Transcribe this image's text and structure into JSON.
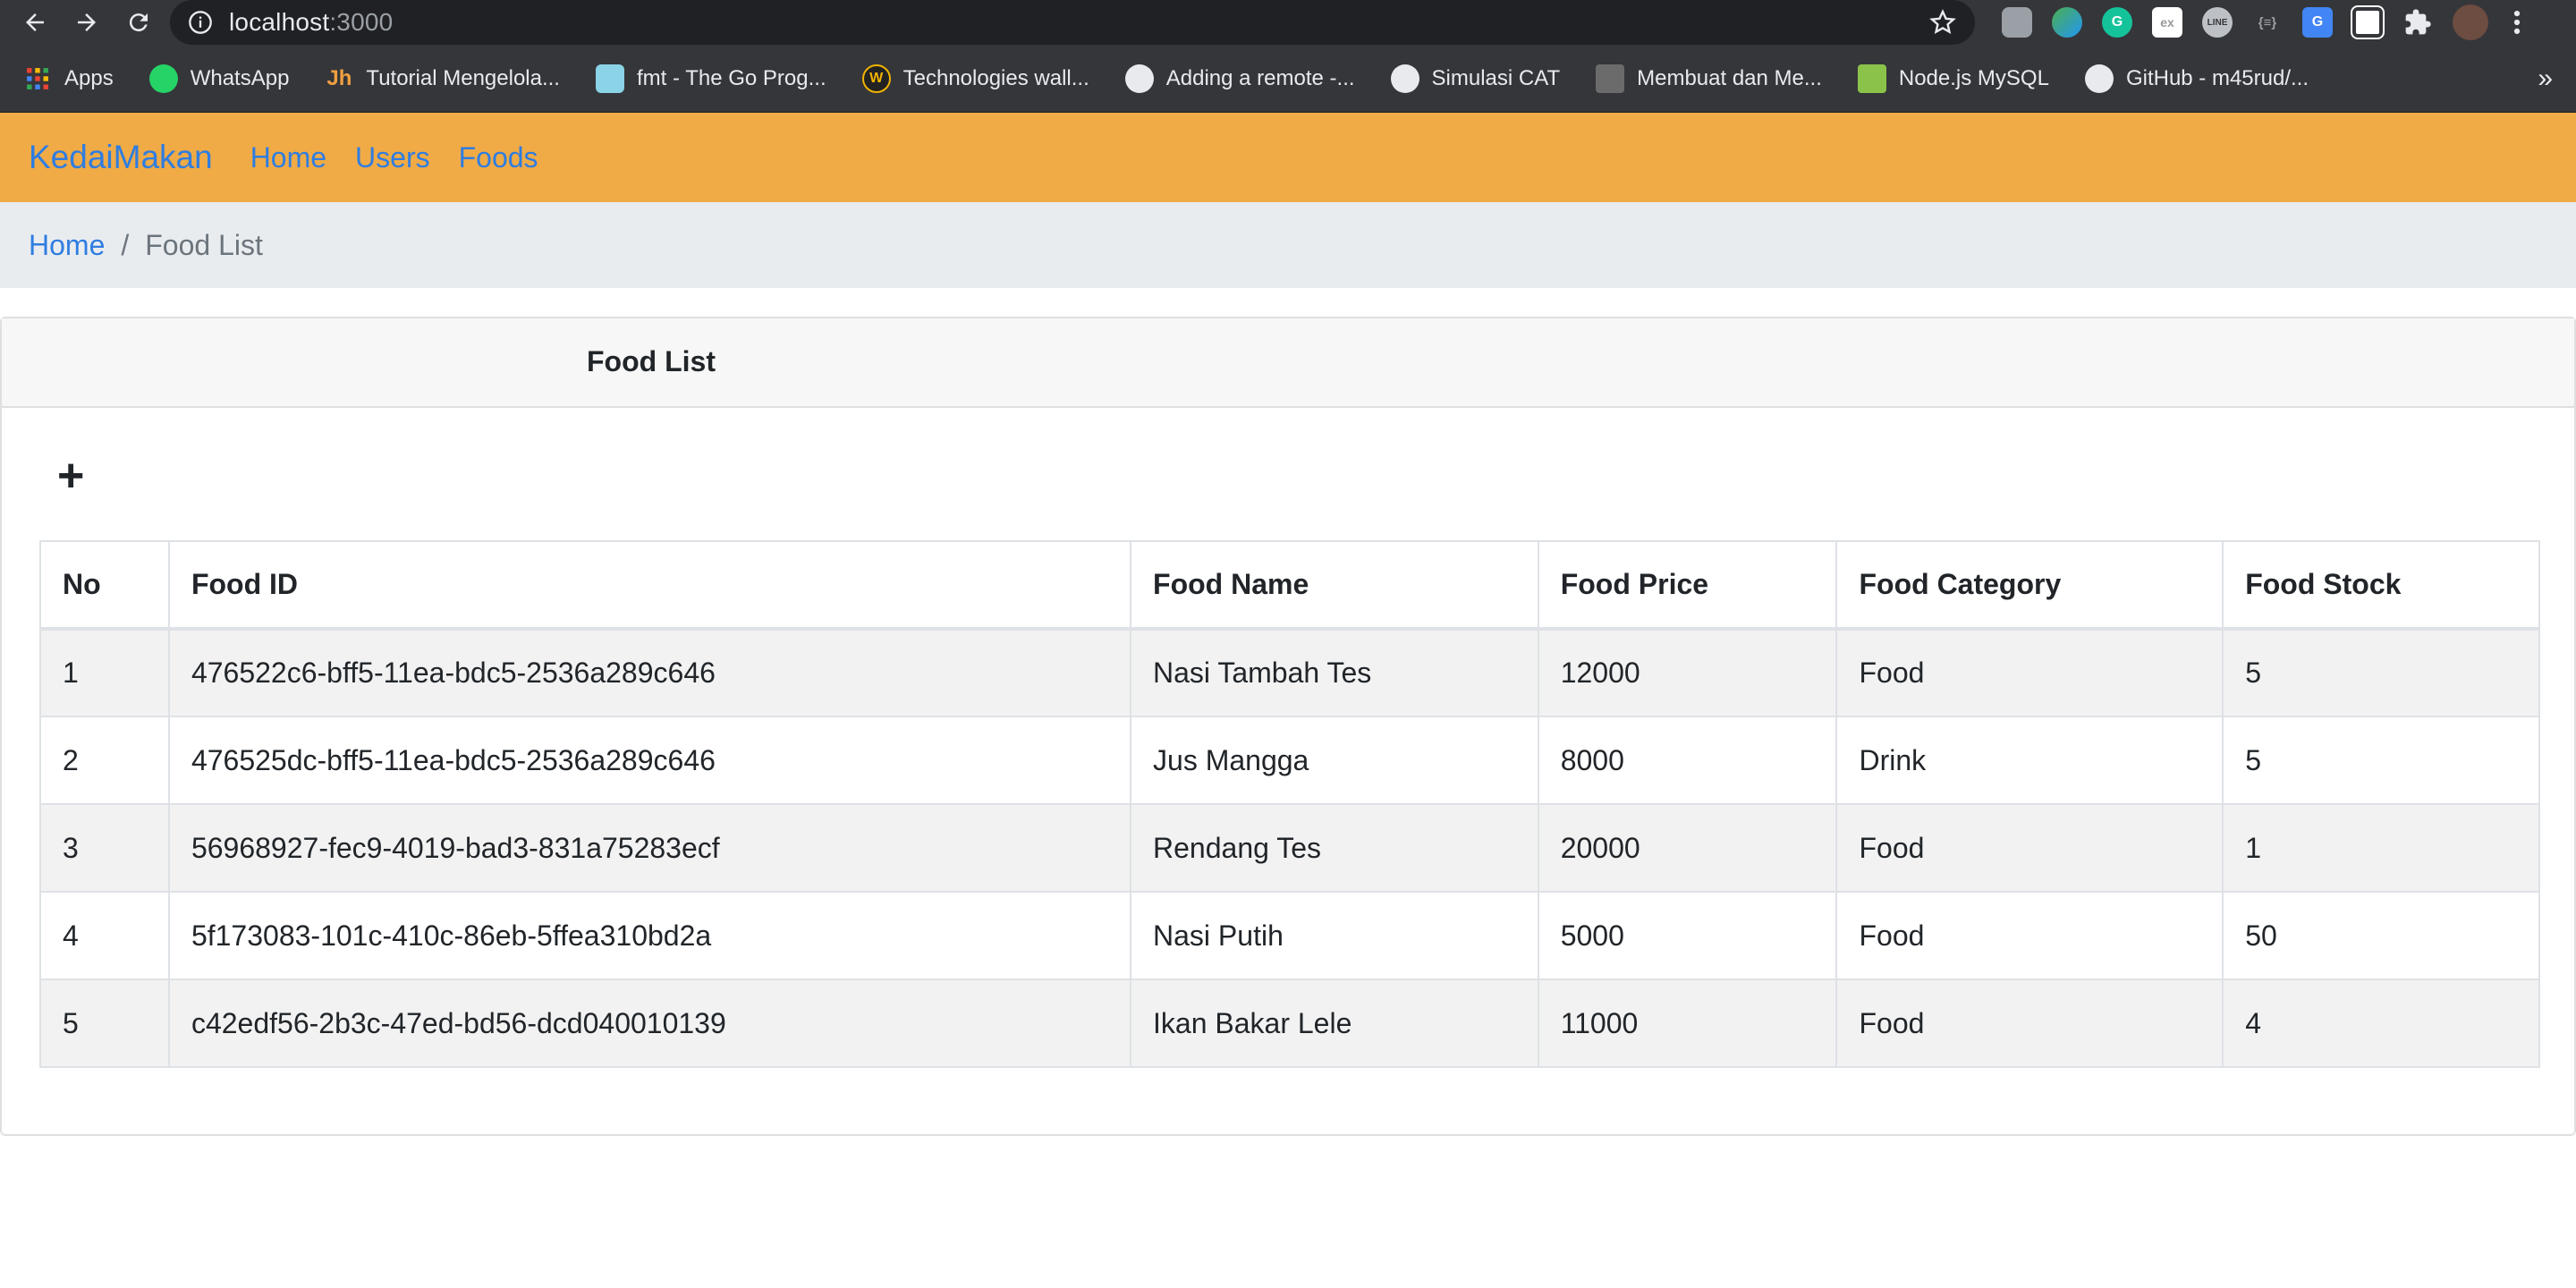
{
  "browser": {
    "url_host": "localhost",
    "url_port": ":3000",
    "bookmarks": [
      {
        "label": "Apps",
        "icon": "apps-grid-icon"
      },
      {
        "label": "WhatsApp",
        "icon": "whatsapp-icon"
      },
      {
        "label": "Tutorial Mengelola...",
        "icon": "jh-logo-icon"
      },
      {
        "label": "fmt - The Go Prog...",
        "icon": "go-gopher-icon"
      },
      {
        "label": "Technologies wall...",
        "icon": "w-badge-icon"
      },
      {
        "label": "Adding a remote -...",
        "icon": "github-icon"
      },
      {
        "label": "Simulasi CAT",
        "icon": "globe-icon"
      },
      {
        "label": "Membuat dan Me...",
        "icon": "code-tag-icon"
      },
      {
        "label": "Node.js MySQL",
        "icon": "w3schools-icon"
      },
      {
        "label": "GitHub - m45rud/...",
        "icon": "github-icon"
      }
    ],
    "more_label": "»"
  },
  "navbar": {
    "brand": "KedaiMakan",
    "links": [
      "Home",
      "Users",
      "Foods"
    ]
  },
  "breadcrumb": {
    "home": "Home",
    "separator": "/",
    "current": "Food List"
  },
  "card": {
    "title": "Food List",
    "add_label": "+"
  },
  "table": {
    "columns": [
      "No",
      "Food ID",
      "Food Name",
      "Food Price",
      "Food Category",
      "Food Stock"
    ],
    "rows": [
      [
        "1",
        "476522c6-bff5-11ea-bdc5-2536a289c646",
        "Nasi Tambah Tes",
        "12000",
        "Food",
        "5"
      ],
      [
        "2",
        "476525dc-bff5-11ea-bdc5-2536a289c646",
        "Jus Mangga",
        "8000",
        "Drink",
        "5"
      ],
      [
        "3",
        "56968927-fec9-4019-bad3-831a75283ecf",
        "Rendang Tes",
        "20000",
        "Food",
        "1"
      ],
      [
        "4",
        "5f173083-101c-410c-86eb-5ffea310bd2a",
        "Nasi Putih",
        "5000",
        "Food",
        "50"
      ],
      [
        "5",
        "c42edf56-2b3c-47ed-bd56-dcd040010139",
        "Ikan Bakar Lele",
        "11000",
        "Food",
        "4"
      ]
    ]
  },
  "colors": {
    "navbar_bg": "#f0ab46",
    "link": "#2f7de1",
    "breadcrumb_bg": "#e9ecef"
  }
}
